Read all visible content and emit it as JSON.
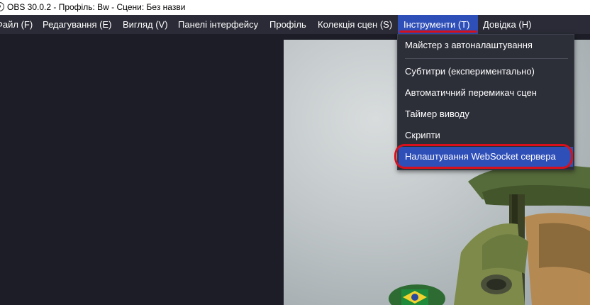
{
  "window": {
    "title": "OBS 30.0.2 - Профіль: Bw - Сцени: Без назви"
  },
  "menubar": {
    "items": [
      {
        "label": "Файл (F)"
      },
      {
        "label": "Редагування (E)"
      },
      {
        "label": "Вигляд (V)"
      },
      {
        "label": "Панелі інтерфейсу"
      },
      {
        "label": "Профіль"
      },
      {
        "label": "Колекція сцен (S)"
      },
      {
        "label": "Інструменти (T)",
        "active": true
      },
      {
        "label": "Довідка (H)"
      }
    ]
  },
  "tools_menu": {
    "items": [
      {
        "label": "Майстер з автоналаштування"
      },
      {
        "label": "Субтитри (експериментально)"
      },
      {
        "label": "Автоматичний перемикач сцен"
      },
      {
        "label": "Таймер виводу"
      },
      {
        "label": "Скрипти"
      },
      {
        "label": "Налаштування WebSocket сервера",
        "selected": true
      }
    ]
  },
  "colors": {
    "menu_active": "#2f4fb8",
    "annotation": "#d8101c",
    "background": "#1c1d26",
    "menubar": "#2a2b36"
  }
}
